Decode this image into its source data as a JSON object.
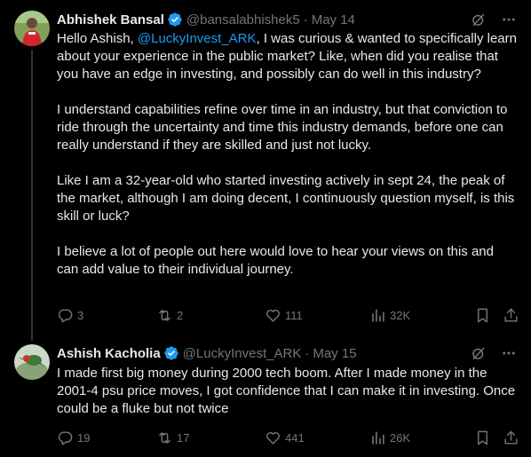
{
  "tweets": [
    {
      "author_name": "Abhishek Bansal",
      "handle": "@bansalabhishek5",
      "separator": "·",
      "date": "May 14",
      "verified_icon": "verified-badge-icon",
      "text_before_mention": "Hello Ashish, ",
      "mention": "@LuckyInvest_ARK",
      "text_after_mention": ", I was curious &  wanted to specifically learn about your experience in the public market?  Like, when did you realise that you have an edge in investing, and possibly can do well in this industry?",
      "paragraph_2": "I understand capabilities refine over time in an industry, but that conviction to ride through the uncertainty and time this industry demands, before one can really understand if they are skilled and just not lucky.",
      "paragraph_3": "Like I am a 32-year-old who started investing actively in sept 24, the peak of the market, although I am doing decent, I continuously question myself, is this skill or luck?",
      "paragraph_4": "I believe a lot of people out here would love to hear your views on this and can add value to their individual journey.",
      "stats": {
        "replies": "3",
        "retweets": "2",
        "likes": "111",
        "views": "32K"
      }
    },
    {
      "author_name": "Ashish Kacholia",
      "handle": "@LuckyInvest_ARK",
      "separator": "·",
      "date": "May 15",
      "verified_icon": "verified-badge-icon",
      "paragraph_1": "I made first big money during 2000 tech boom. After I made money in the 2001-4 psu price moves, I got confidence that I can make it in investing. Once could be a fluke but not twice",
      "stats": {
        "replies": "19",
        "retweets": "17",
        "likes": "441",
        "views": "26K"
      }
    }
  ],
  "colors": {
    "background": "#000000",
    "text": "#e7e9ea",
    "secondary": "#71767b",
    "accent": "#1d9bf0",
    "divider": "#2f3336"
  }
}
